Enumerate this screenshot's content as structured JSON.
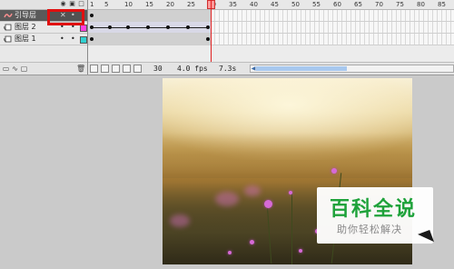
{
  "layers": {
    "header_icons": [
      "eye-icon",
      "lock-icon",
      "outline-icon"
    ],
    "items": [
      {
        "name": "引导层",
        "kind": "guide",
        "icon": "guide-layer-icon",
        "eye": "✕",
        "lock": "•",
        "color": "#6aa0ff"
      },
      {
        "name": "图层 2",
        "kind": "normal",
        "icon": "layer-icon",
        "eye": "•",
        "lock": "•",
        "color": "#ff40e0"
      },
      {
        "name": "图层 1",
        "kind": "normal",
        "icon": "layer-icon",
        "eye": "•",
        "lock": "•",
        "color": "#30d0d0"
      }
    ]
  },
  "ruler": {
    "ticks": [
      "1",
      "5",
      "10",
      "15",
      "20",
      "25",
      "30",
      "35",
      "40",
      "45",
      "50",
      "55",
      "60",
      "65",
      "70",
      "75",
      "80",
      "85"
    ]
  },
  "status": {
    "frame": "30",
    "fps": "4.0 fps",
    "time": "7.3s"
  },
  "watermark": {
    "title": "百科全说",
    "subtitle": "助你轻松解决"
  },
  "colors": {
    "highlight": "#e01010",
    "playhead": "#e02020",
    "watermark_green": "#1ea23a"
  }
}
